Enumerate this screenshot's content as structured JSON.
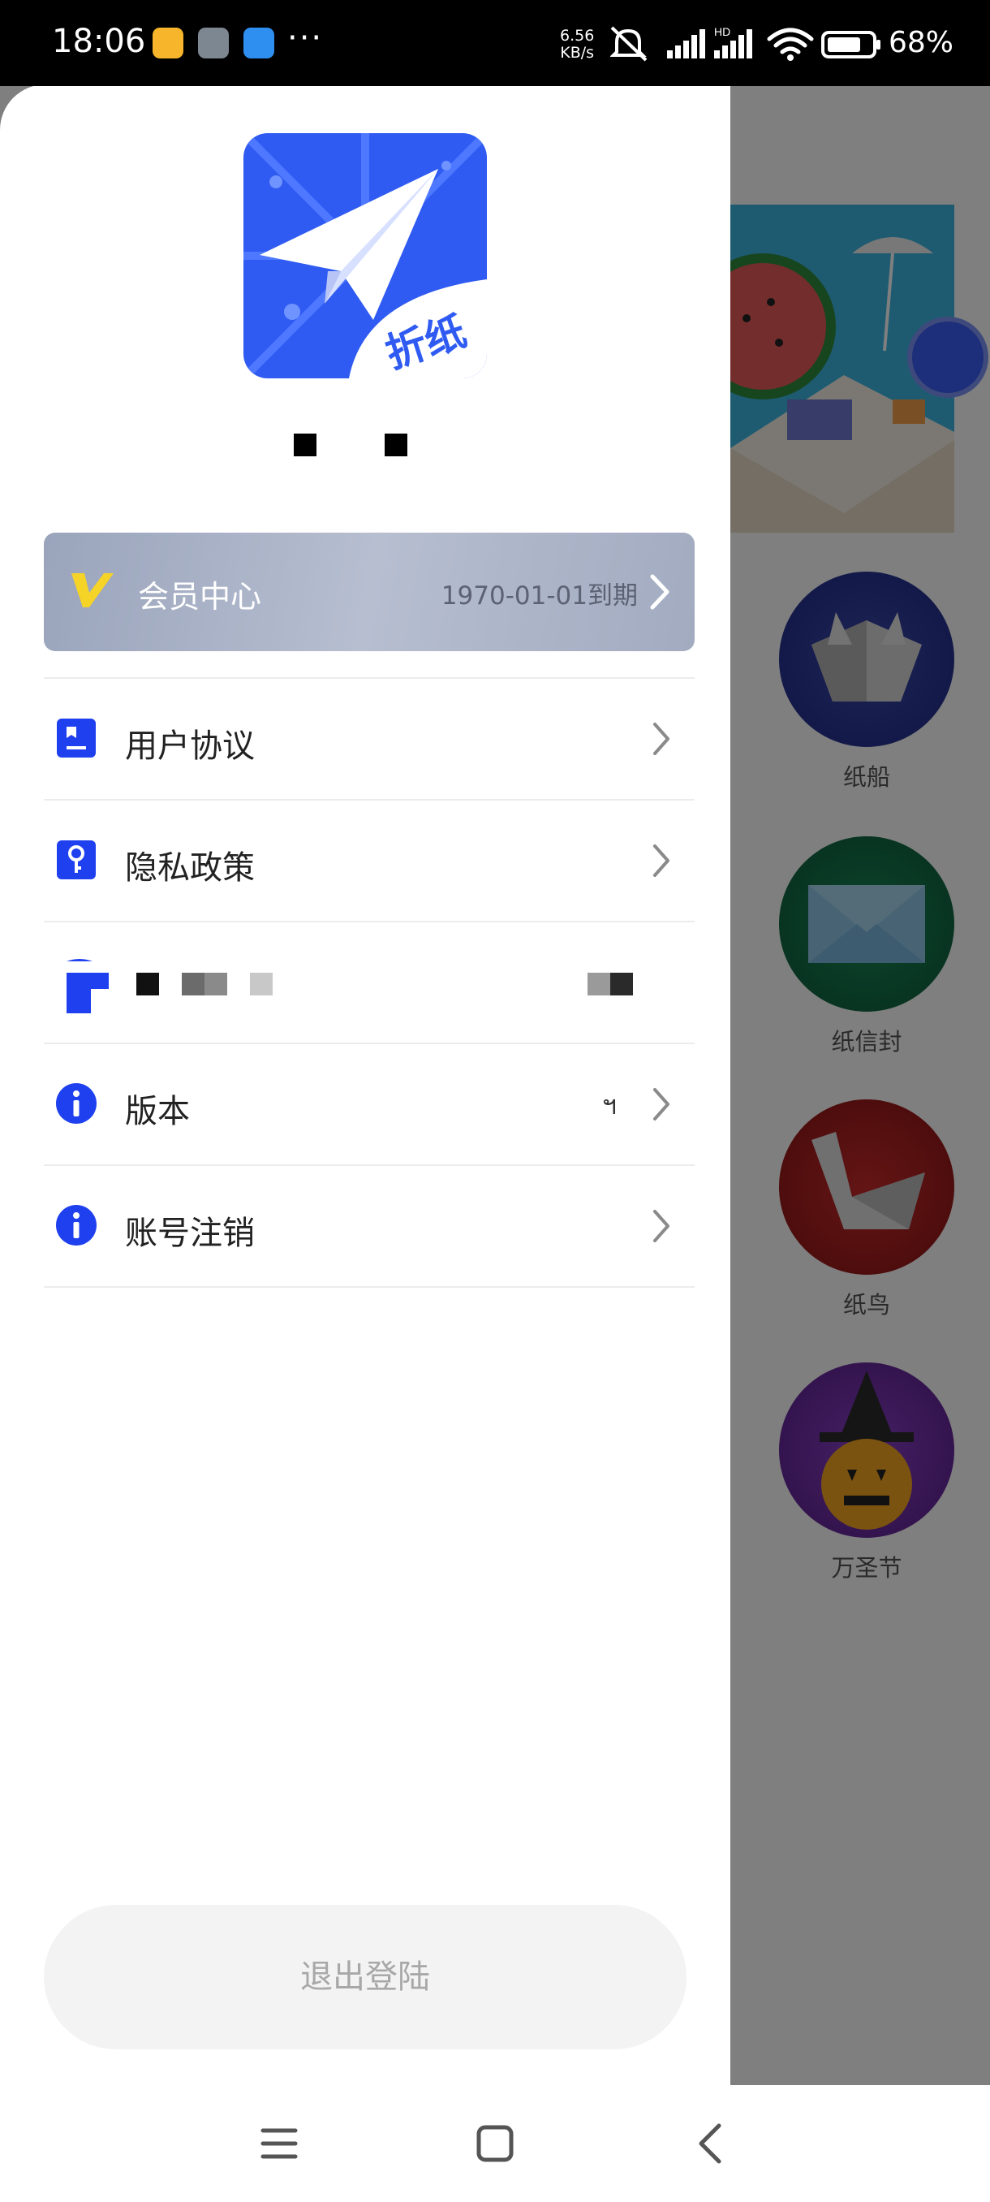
{
  "status_bar": {
    "time": "18:06",
    "network_speed_value": "6.56",
    "network_speed_unit": "KB/s",
    "signal_label": "HD",
    "battery_percent": "68%"
  },
  "drawer": {
    "vip": {
      "title": "会员中心",
      "expiry": "1970-01-01到期"
    },
    "menu": [
      {
        "label": "用户协议",
        "icon": "document-icon"
      },
      {
        "label": "隐私政策",
        "icon": "key-icon"
      },
      {
        "label": "",
        "icon": "brand-icon"
      },
      {
        "label": "版本",
        "icon": "info-icon",
        "value": "ฯ"
      },
      {
        "label": "账号注销",
        "icon": "info-icon"
      }
    ],
    "logout_label": "退出登陆"
  },
  "background_app": {
    "categories": [
      {
        "label": "纸船"
      },
      {
        "label": "纸信封"
      },
      {
        "label": "纸鸟"
      },
      {
        "label": "万圣节"
      }
    ]
  },
  "colors": {
    "accent": "#1f40ef",
    "vip_gold": "#f5d327",
    "logo_blue": "#2f5bf2"
  }
}
